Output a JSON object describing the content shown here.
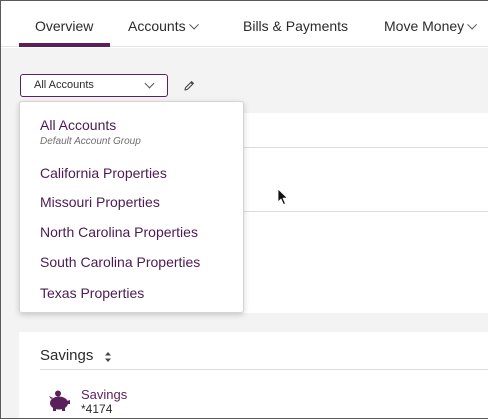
{
  "nav": {
    "tabs": [
      {
        "label": "Overview",
        "active": true
      },
      {
        "label": "Accounts",
        "has_dropdown": true
      },
      {
        "label": "Bills & Payments"
      },
      {
        "label": "Move Money",
        "has_dropdown": true
      }
    ]
  },
  "account_selector": {
    "selected": "All Accounts",
    "edit_icon": "pencil-icon"
  },
  "dropdown": {
    "items": [
      {
        "label": "All Accounts",
        "sublabel": "Default Account Group"
      },
      {
        "label": "California Properties"
      },
      {
        "label": "Missouri Properties"
      },
      {
        "label": "North Carolina Properties"
      },
      {
        "label": "South Carolina Properties"
      },
      {
        "label": "Texas Properties"
      }
    ]
  },
  "savings": {
    "header": "Savings",
    "sort_icon": "sort-icon",
    "accounts": [
      {
        "name": "Savings",
        "number": "*4174",
        "icon": "piggy-bank-icon"
      }
    ]
  },
  "colors": {
    "brand": "#5b1f5c",
    "link": "#4d1a52",
    "background": "#f3f3f3"
  }
}
